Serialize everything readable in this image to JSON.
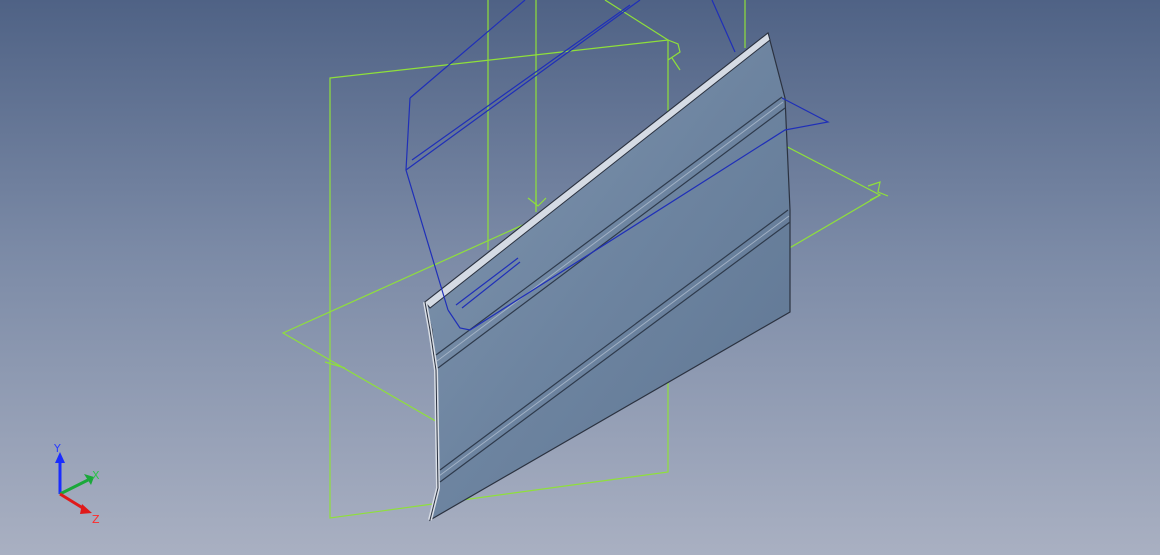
{
  "viewport": {
    "background_top": "#4f6285",
    "background_bottom": "#a9b0c2"
  },
  "colors": {
    "datum_plane": "#8fe03a",
    "sketch": "#1f2fb8",
    "part_face": "#6f87a3",
    "part_edge": "#2b3240"
  },
  "triad": {
    "y_label": "Y",
    "x_label": "X",
    "z_label": "Z",
    "y_color": "#1a2cff",
    "x_color": "#1aa83a",
    "z_color": "#e01a1a"
  }
}
